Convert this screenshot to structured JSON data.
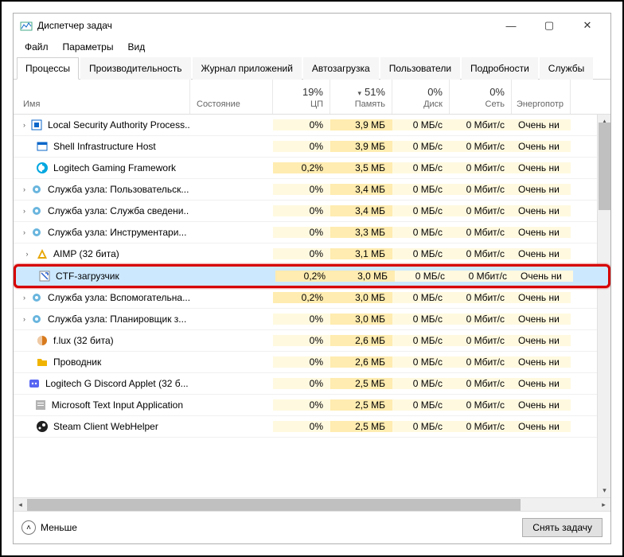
{
  "window": {
    "title": "Диспетчер задач",
    "controls": {
      "min": "—",
      "max": "▢",
      "close": "✕"
    }
  },
  "menu": {
    "file": "Файл",
    "options": "Параметры",
    "view": "Вид"
  },
  "tabs": {
    "processes": "Процессы",
    "performance": "Производительность",
    "app_history": "Журнал приложений",
    "startup": "Автозагрузка",
    "users": "Пользователи",
    "details": "Подробности",
    "services": "Службы"
  },
  "columns": {
    "name": "Имя",
    "status": "Состояние",
    "cpu_pct": "19%",
    "cpu_label": "ЦП",
    "mem_pct": "51%",
    "mem_label": "Память",
    "disk_pct": "0%",
    "disk_label": "Диск",
    "net_pct": "0%",
    "net_label": "Сеть",
    "power_label": "Энергопотр"
  },
  "footer": {
    "fewer": "Меньше",
    "end_task": "Снять задачу"
  },
  "processes": [
    {
      "expandable": true,
      "icon": "shield-icon",
      "icon_color": "#0b67c9",
      "name": "Local Security Authority Process...",
      "cpu": "0%",
      "mem": "3,9 МБ",
      "disk": "0 МБ/с",
      "net": "0 Мбит/с",
      "power": "Очень ни",
      "highlighted": false
    },
    {
      "expandable": false,
      "icon": "window-icon",
      "icon_color": "#0b67c9",
      "name": "Shell Infrastructure Host",
      "cpu": "0%",
      "mem": "3,9 МБ",
      "disk": "0 МБ/с",
      "net": "0 Мбит/с",
      "power": "Очень ни",
      "highlighted": false
    },
    {
      "expandable": false,
      "icon": "logitech-icon",
      "icon_color": "#00a7e0",
      "name": "Logitech Gaming Framework",
      "cpu": "0,2%",
      "mem": "3,5 МБ",
      "disk": "0 МБ/с",
      "net": "0 Мбит/с",
      "power": "Очень ни",
      "highlighted": false
    },
    {
      "expandable": true,
      "icon": "gear-icon",
      "icon_color": "#2a95d0",
      "name": "Служба узла: Пользовательск...",
      "cpu": "0%",
      "mem": "3,4 МБ",
      "disk": "0 МБ/с",
      "net": "0 Мбит/с",
      "power": "Очень ни",
      "highlighted": false
    },
    {
      "expandable": true,
      "icon": "gear-icon",
      "icon_color": "#2a95d0",
      "name": "Служба узла: Служба сведени...",
      "cpu": "0%",
      "mem": "3,4 МБ",
      "disk": "0 МБ/с",
      "net": "0 Мбит/с",
      "power": "Очень ни",
      "highlighted": false
    },
    {
      "expandable": true,
      "icon": "gear-icon",
      "icon_color": "#2a95d0",
      "name": "Служба узла: Инструментари...",
      "cpu": "0%",
      "mem": "3,3 МБ",
      "disk": "0 МБ/с",
      "net": "0 Мбит/с",
      "power": "Очень ни",
      "highlighted": false
    },
    {
      "expandable": true,
      "icon": "aimp-icon",
      "icon_color": "#e6a500",
      "name": "AIMP (32 бита)",
      "cpu": "0%",
      "mem": "3,1 МБ",
      "disk": "0 МБ/с",
      "net": "0 Мбит/с",
      "power": "Очень ни",
      "highlighted": false
    },
    {
      "expandable": false,
      "icon": "ctf-icon",
      "icon_color": "#2a5fc9",
      "name": "CTF-загрузчик",
      "cpu": "0,2%",
      "mem": "3,0 МБ",
      "disk": "0 МБ/с",
      "net": "0 Мбит/с",
      "power": "Очень ни",
      "highlighted": true
    },
    {
      "expandable": true,
      "icon": "gear-icon",
      "icon_color": "#2a95d0",
      "name": "Служба узла: Вспомогательна...",
      "cpu": "0,2%",
      "mem": "3,0 МБ",
      "disk": "0 МБ/с",
      "net": "0 Мбит/с",
      "power": "Очень ни",
      "highlighted": false
    },
    {
      "expandable": true,
      "icon": "gear-icon",
      "icon_color": "#2a95d0",
      "name": "Служба узла: Планировщик з...",
      "cpu": "0%",
      "mem": "3,0 МБ",
      "disk": "0 МБ/с",
      "net": "0 Мбит/с",
      "power": "Очень ни",
      "highlighted": false
    },
    {
      "expandable": false,
      "icon": "flux-icon",
      "icon_color": "#d77a1d",
      "name": "f.lux (32 бита)",
      "cpu": "0%",
      "mem": "2,6 МБ",
      "disk": "0 МБ/с",
      "net": "0 Мбит/с",
      "power": "Очень ни",
      "highlighted": false
    },
    {
      "expandable": false,
      "icon": "explorer-icon",
      "icon_color": "#f0b400",
      "name": "Проводник",
      "cpu": "0%",
      "mem": "2,6 МБ",
      "disk": "0 МБ/с",
      "net": "0 Мбит/с",
      "power": "Очень ни",
      "highlighted": false
    },
    {
      "expandable": false,
      "icon": "discord-icon",
      "icon_color": "#5865f2",
      "name": "Logitech G Discord Applet (32 б...",
      "cpu": "0%",
      "mem": "2,5 МБ",
      "disk": "0 МБ/с",
      "net": "0 Мбит/с",
      "power": "Очень ни",
      "highlighted": false
    },
    {
      "expandable": false,
      "icon": "textapp-icon",
      "icon_color": "#808080",
      "name": "Microsoft Text Input Application",
      "cpu": "0%",
      "mem": "2,5 МБ",
      "disk": "0 МБ/с",
      "net": "0 Мбит/с",
      "power": "Очень ни",
      "highlighted": false
    },
    {
      "expandable": false,
      "icon": "steam-icon",
      "icon_color": "#202020",
      "name": "Steam Client WebHelper",
      "cpu": "0%",
      "mem": "2,5 МБ",
      "disk": "0 МБ/с",
      "net": "0 Мбит/с",
      "power": "Очень ни",
      "highlighted": false
    }
  ]
}
